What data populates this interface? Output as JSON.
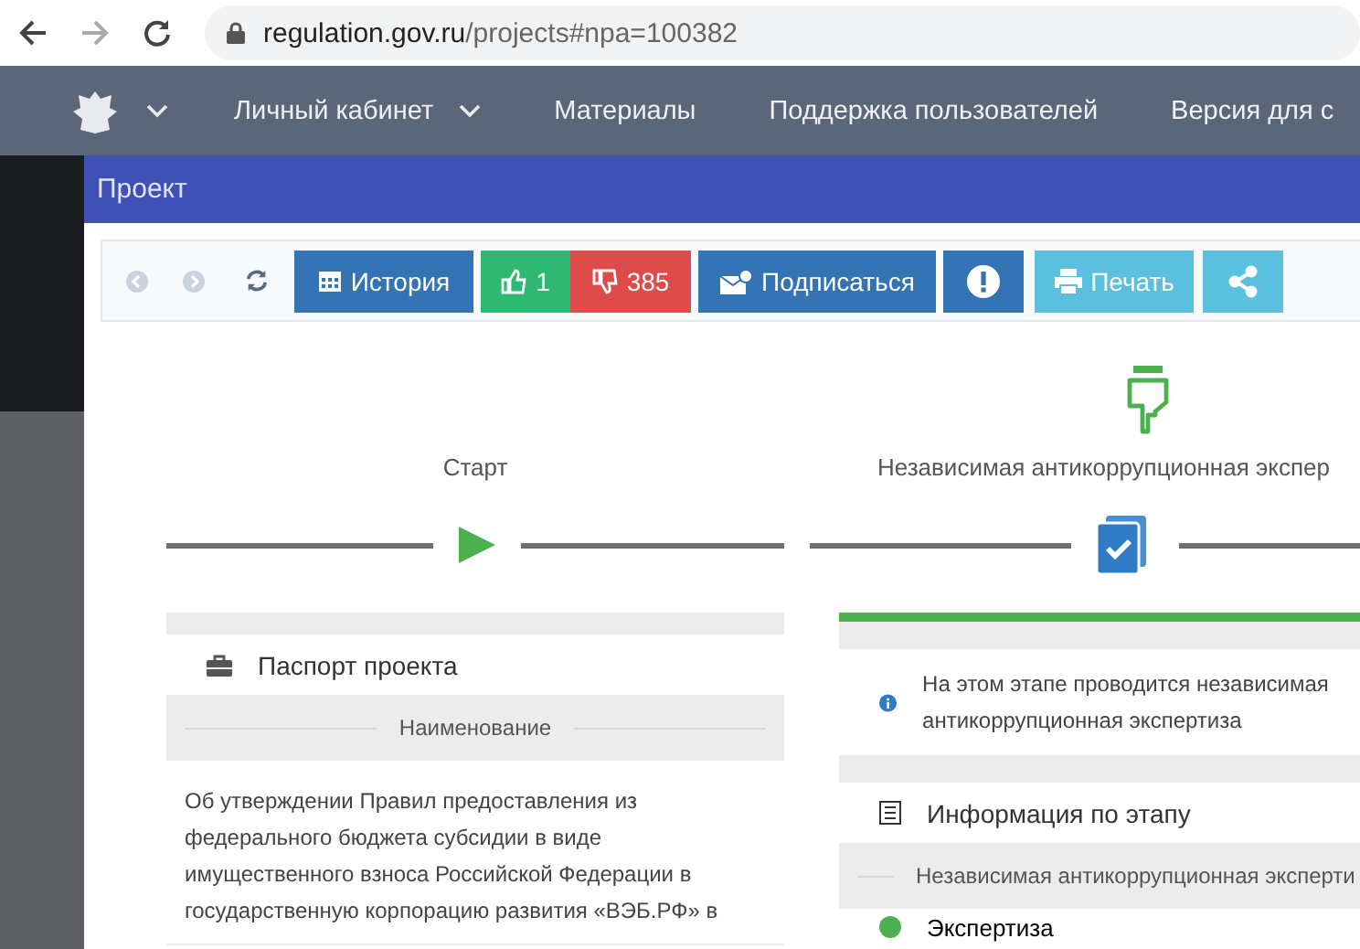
{
  "browser": {
    "url_host": "regulation.gov.ru",
    "url_path": "/projects#npa=100382"
  },
  "nav": {
    "items": [
      {
        "label": "Личный кабинет",
        "dropdown": true
      },
      {
        "label": "Материалы",
        "dropdown": false
      },
      {
        "label": "Поддержка пользователей",
        "dropdown": false
      },
      {
        "label": "Версия для с",
        "dropdown": false
      }
    ]
  },
  "modal": {
    "title": "Проект"
  },
  "toolbar": [
    {
      "kind": "back",
      "disabled": true
    },
    {
      "kind": "forward",
      "disabled": true
    },
    {
      "kind": "refresh",
      "disabled": false
    },
    {
      "kind": "history",
      "label": "История"
    },
    {
      "kind": "like",
      "label": "1"
    },
    {
      "kind": "dislike",
      "label": "385"
    },
    {
      "kind": "subscribe",
      "label": "Подписаться"
    },
    {
      "kind": "alert"
    },
    {
      "kind": "print",
      "label": "Печать"
    },
    {
      "kind": "share"
    }
  ],
  "stages": [
    {
      "kind": "start",
      "label": "Старт"
    },
    {
      "kind": "current",
      "label": "Независимая антикоррупционная экспер"
    }
  ],
  "passport": {
    "title": "Паспорт проекта",
    "section": "Наименование",
    "text": "Об утверждении Правил предоставления из федерального бюджета субсидии в виде имущественного взноса Российской Федерации в государственную корпорацию развития «ВЭБ.РФ» в"
  },
  "stage_info": {
    "notice": "На этом этапе проводится независимая антикоррупционная экспертиза",
    "title": "Информация по этапу",
    "section": "Независимая антикоррупционная эксперти",
    "step": "Экспертиза"
  }
}
